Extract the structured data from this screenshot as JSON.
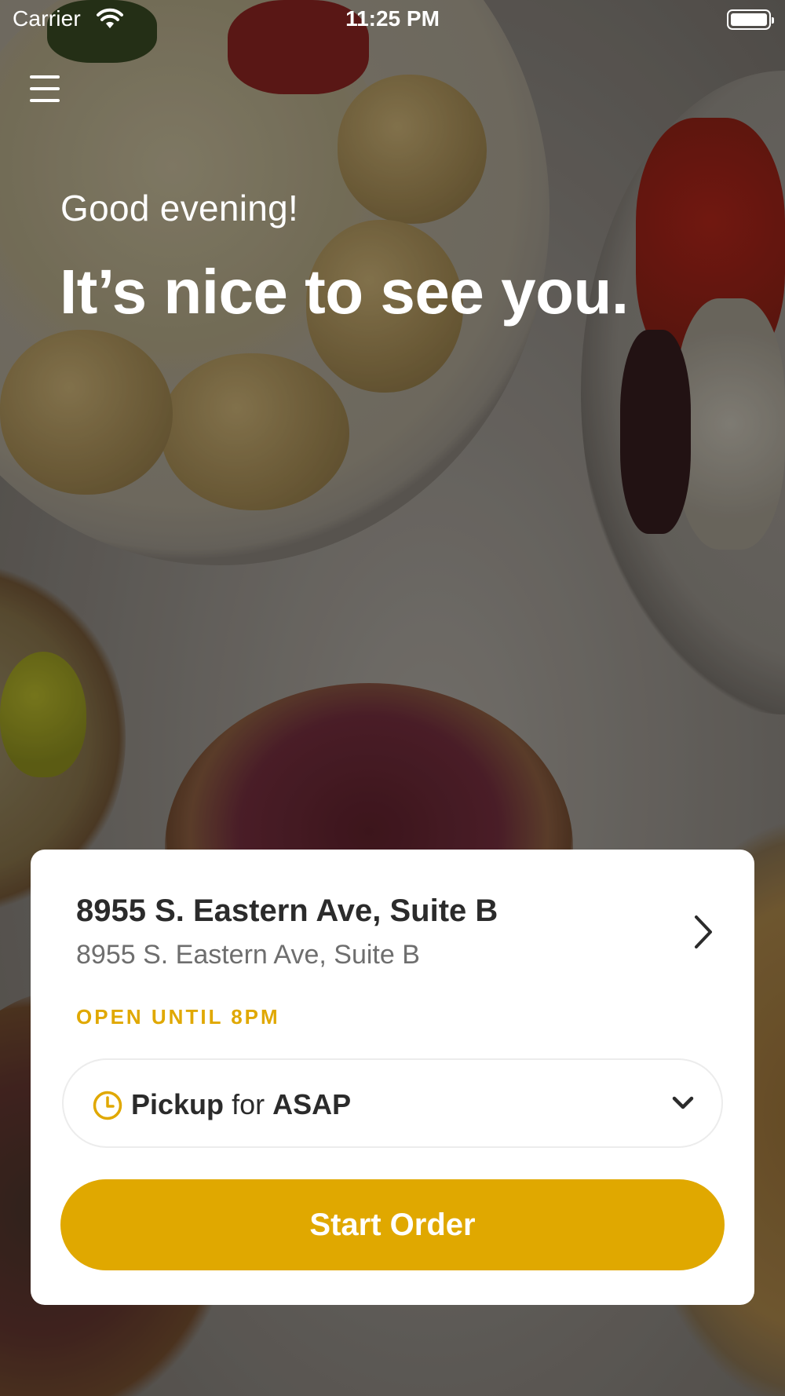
{
  "status_bar": {
    "carrier": "Carrier",
    "time": "11:25 PM"
  },
  "header": {
    "menu_icon": "hamburger-menu-icon",
    "greeting": "Good evening!",
    "headline": "It’s nice to see you."
  },
  "location_card": {
    "name": "8955 S. Eastern Ave, Suite B",
    "address": "8955 S. Eastern Ave, Suite B",
    "hours": "OPEN UNTIL 8PM",
    "chevron_icon": "chevron-right-icon"
  },
  "order_mode": {
    "icon": "clock-icon",
    "mode": "Pickup",
    "connector": "for",
    "when": "ASAP",
    "dropdown_icon": "chevron-down-icon"
  },
  "actions": {
    "start_order": "Start Order"
  },
  "colors": {
    "accent": "#e0a800",
    "card_bg": "#ffffff",
    "text_primary": "#2b2b2b",
    "text_secondary": "#6e6e6e"
  }
}
